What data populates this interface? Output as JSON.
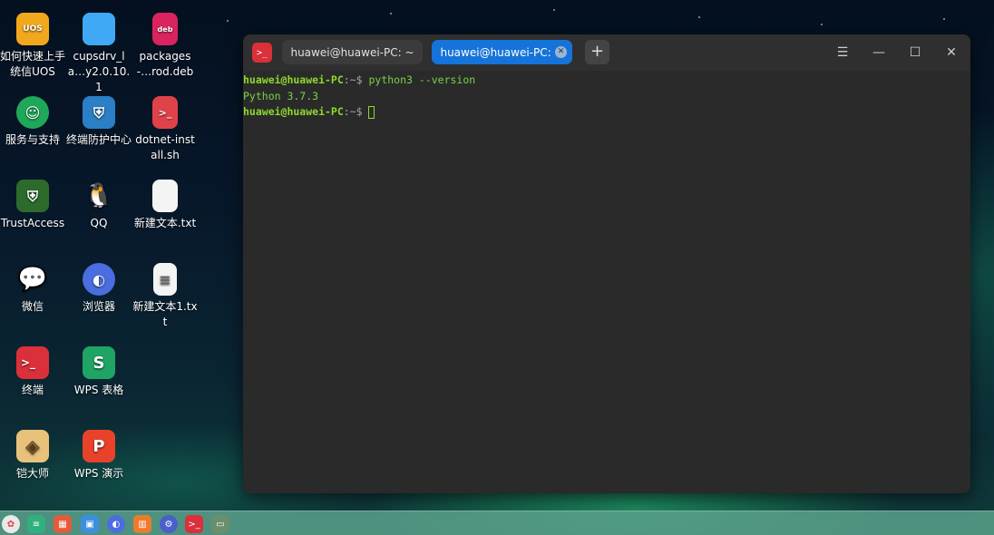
{
  "desktop": {
    "icons": [
      {
        "label": "如何快速上手统信UOS",
        "icon": "uos-guide-icon",
        "color": "#f2a81d",
        "glyph": "UOS"
      },
      {
        "label": "cupsdrv_la…y2.0.10.1",
        "icon": "folder-icon",
        "color": "#3fa9f5",
        "glyph": ""
      },
      {
        "label": "packages-…rod.deb",
        "icon": "deb-package-icon",
        "color": "#d9245f",
        "glyph": "deb"
      },
      {
        "label": "服务与支持",
        "icon": "support-icon",
        "color": "#1fa85a",
        "glyph": "☺"
      },
      {
        "label": "终端防护中心",
        "icon": "shield-icon",
        "color": "#2a7fc6",
        "glyph": "⛨"
      },
      {
        "label": "dotnet-install.sh",
        "icon": "shell-script-icon",
        "color": "#e0424a",
        "glyph": ">_"
      },
      {
        "label": "TrustAccess",
        "icon": "trustaccess-icon",
        "color": "#2c6b2c",
        "glyph": "⛨"
      },
      {
        "label": "QQ",
        "icon": "qq-penguin-icon",
        "color": "#222222",
        "glyph": "🐧"
      },
      {
        "label": "新建文本.txt",
        "icon": "text-file-icon",
        "color": "#f4f4f4",
        "glyph": ""
      },
      {
        "label": "微信",
        "icon": "wechat-icon",
        "color": "#2dc100",
        "glyph": "💬"
      },
      {
        "label": "浏览器",
        "icon": "browser-icon",
        "color": "#4a6ee0",
        "glyph": "◐"
      },
      {
        "label": "新建文本1.txt",
        "icon": "text-file-icon",
        "color": "#f4f4f4",
        "glyph": "≡"
      },
      {
        "label": "终端",
        "icon": "terminal-icon",
        "color": "#d9303a",
        "glyph": ">_"
      },
      {
        "label": "WPS 表格",
        "icon": "wps-sheet-icon",
        "color": "#1fa463",
        "glyph": "S"
      },
      {
        "label": "铠大师",
        "icon": "kaidashi-icon",
        "color": "#e8c27a",
        "glyph": "◈"
      },
      {
        "label": "WPS 演示",
        "icon": "wps-presentation-icon",
        "color": "#e8432a",
        "glyph": "P"
      }
    ]
  },
  "terminal": {
    "tabs": [
      {
        "label": "huawei@huawei-PC: ~"
      },
      {
        "label": "huawei@huawei-PC: ~"
      }
    ],
    "add_tab": "+",
    "menu": "☰",
    "minimize": "—",
    "maximize": "☐",
    "close": "✕",
    "prompt_user": "huawei@huawei-PC",
    "prompt_path": ":~$ ",
    "command1": "python3 --version",
    "output1": "Python 3.7.3"
  },
  "taskbar": {
    "items": [
      {
        "icon": "launcher-icon",
        "color": "#e9e9e9"
      },
      {
        "icon": "multitask-view-icon",
        "color": "#2fb07d"
      },
      {
        "icon": "app-store-icon",
        "color": "#e35b39"
      },
      {
        "icon": "file-manager-icon",
        "color": "#3b8fe0"
      },
      {
        "icon": "browser-icon",
        "color": "#4a6ee0"
      },
      {
        "icon": "calendar-icon",
        "color": "#ee7b2b"
      },
      {
        "icon": "settings-gear-icon",
        "color": "#4a5fc8"
      },
      {
        "icon": "terminal-icon",
        "color": "#d9303a"
      },
      {
        "icon": "screen-recorder-icon",
        "color": "#6b8f6b"
      }
    ]
  }
}
